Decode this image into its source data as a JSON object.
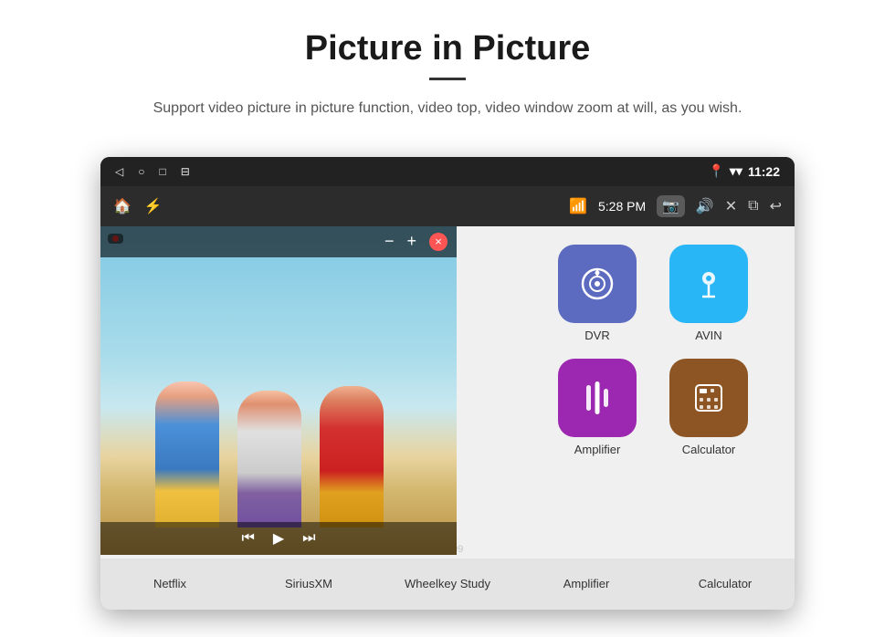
{
  "header": {
    "title": "Picture in Picture",
    "subtitle": "Support video picture in picture function, video top, video window zoom at will, as you wish."
  },
  "status_bar": {
    "back_icon": "◁",
    "circle_icon": "○",
    "square_icon": "□",
    "menu_icon": "⊟",
    "wifi_icon": "▾",
    "signal_icon": "▾",
    "time": "11:22"
  },
  "toolbar": {
    "home_icon": "⌂",
    "usb_icon": "⌁",
    "wifi_icon": "▾",
    "time": "5:28 PM",
    "camera_icon": "📷",
    "volume_icon": "🔊",
    "close_icon": "✕",
    "pip_icon": "⧉",
    "back_icon": "↩"
  },
  "pip": {
    "record_label": "●",
    "minus_label": "−",
    "plus_label": "+",
    "close_label": "×",
    "prev_label": "⏮",
    "play_label": "▶",
    "next_label": "⏭"
  },
  "apps": {
    "row1": [
      {
        "id": "netflix",
        "label": "Netflix",
        "color": "#4caf50",
        "visible": false
      },
      {
        "id": "siriusxm",
        "label": "SiriusXM",
        "color": "#e91e8c",
        "visible": false
      },
      {
        "id": "wheelkey",
        "label": "Wheelkey Study",
        "color": "#7b1fa2",
        "visible": false
      }
    ],
    "row2": [
      {
        "id": "dvr",
        "label": "DVR",
        "icon": "📡",
        "bg": "#5c6bc0"
      },
      {
        "id": "avin",
        "label": "AVIN",
        "icon": "🎛",
        "bg": "#29b6f6"
      }
    ],
    "row3": [
      {
        "id": "amplifier",
        "label": "Amplifier",
        "icon": "🎚",
        "bg": "#9c27b0"
      },
      {
        "id": "calculator",
        "label": "Calculator",
        "icon": "🧮",
        "bg": "#8d5524"
      }
    ]
  },
  "bottom_labels": {
    "netflix": "Netflix",
    "siriusxm": "SiriusXM",
    "wheelkey": "Wheelkey Study",
    "amplifier": "Amplifier",
    "calculator": "Calculator"
  }
}
